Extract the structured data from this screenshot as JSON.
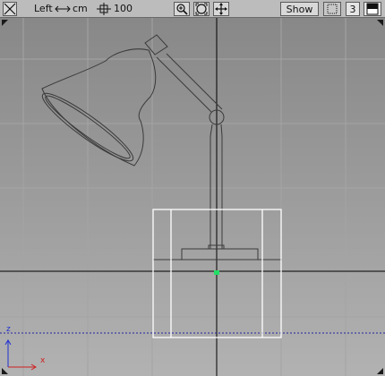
{
  "toolbar": {
    "view_name": "Left",
    "unit_label": "cm",
    "grid_size": "100",
    "show_label": "Show",
    "layer_count": "3",
    "icons": [
      "close-view-icon",
      "width-arrows-icon",
      "grid-size-icon",
      "zoom-icon",
      "frame-icon",
      "pan-icon",
      "layout-icon",
      "maximize-icon"
    ]
  },
  "viewport": {
    "axis_x_label": "x",
    "axis_z_label": "z",
    "colors": {
      "grid": "#a2a2a2",
      "center_line": "#000000",
      "ground_line": "#2323a0",
      "selection": "#ffffff",
      "pivot": "#22dd66",
      "axis_x": "#d02020",
      "axis_z": "#2030d0"
    }
  }
}
